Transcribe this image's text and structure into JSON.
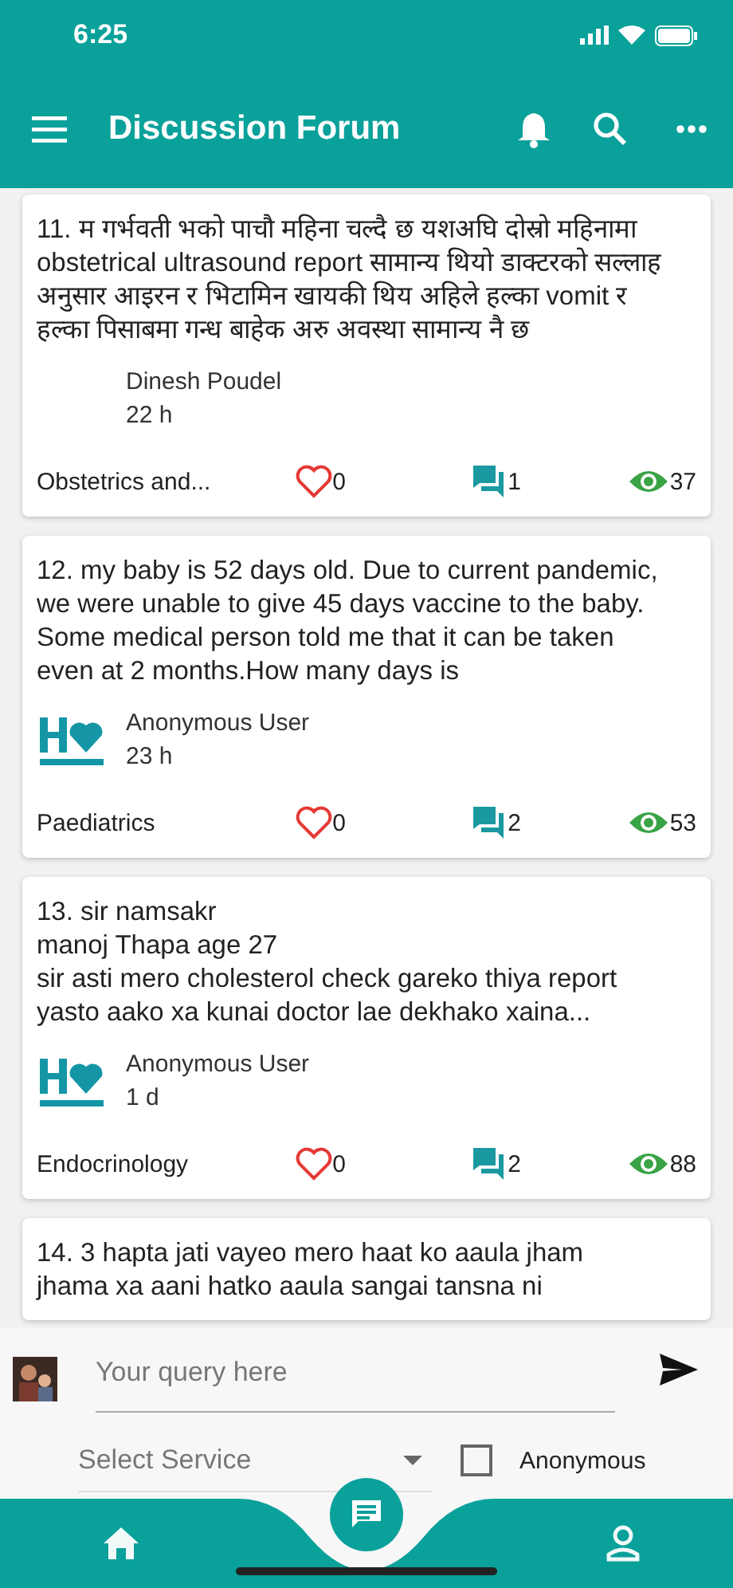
{
  "status_bar": {
    "time": "6:25"
  },
  "header": {
    "title": "Discussion Forum"
  },
  "posts": [
    {
      "text": "11. म गर्भवती भको पाचौ महिना चल्दै छ यशअघि दोस्रो महिनामा obstetrical ultrasound report सामान्य थियो डाक्टरको सल्लाह अनुसार आइरन र भिटामिन खायकी थिय अहिले हल्का vomit र हल्का पिसाबमा गन्ध बाहेक अरु अवस्था सामान्य नै छ",
      "logo": false,
      "author": "Dinesh Poudel",
      "time": "22 h",
      "category": "Obstetrics and...",
      "likes": "0",
      "comments": "1",
      "views": "37"
    },
    {
      "text": "12. my baby is 52 days old. Due to current pandemic, we were unable to give 45 days vaccine to the baby. Some medical person told me that it can be taken even at 2 months.How many days is",
      "logo": true,
      "author": "Anonymous User",
      "time": "23 h",
      "category": "Paediatrics",
      "likes": "0",
      "comments": "2",
      "views": "53"
    },
    {
      "text": "13. sir namsakr\nmanoj Thapa age 27\nsir asti mero cholesterol check gareko thiya report yasto aako xa kunai doctor lae dekhako xaina...",
      "logo": true,
      "author": "Anonymous User",
      "time": "1 d",
      "category": "Endocrinology",
      "likes": "0",
      "comments": "2",
      "views": "88"
    },
    {
      "text": "14. 3 hapta jati vayeo mero haat ko aaula jham jhama xa aani hatko aaula sangai tansna ni"
    }
  ],
  "composer": {
    "placeholder": "Your query here",
    "service_placeholder": "Select Service",
    "anonymous": {
      "label": "Anonymous",
      "checked": false
    }
  },
  "bottom_nav": [
    {
      "kind": "home",
      "selected": false
    },
    {
      "kind": "chat",
      "selected": true
    },
    {
      "kind": "profile",
      "selected": false
    }
  ]
}
